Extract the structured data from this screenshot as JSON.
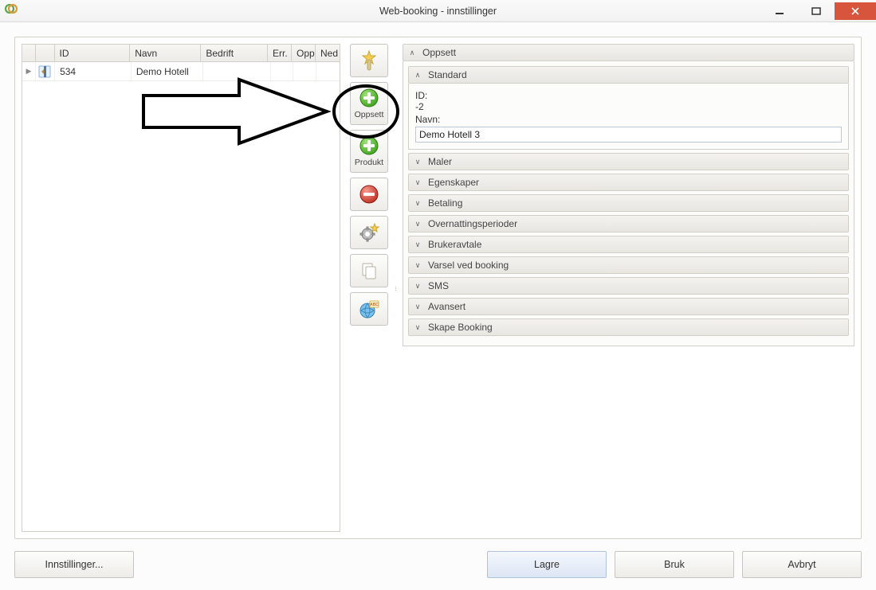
{
  "window": {
    "title": "Web-booking - innstillinger"
  },
  "grid": {
    "columns": {
      "id": "ID",
      "navn": "Navn",
      "bedrift": "Bedrift",
      "err": "Err.",
      "opp": "Opp",
      "ned": "Ned"
    },
    "rows": [
      {
        "id": "534",
        "navn": "Demo Hotell",
        "bedrift": "",
        "err": "",
        "opp": "",
        "ned": ""
      }
    ]
  },
  "toolbar": {
    "oppsett_label": "Oppsett",
    "produkt_label": "Produkt"
  },
  "accordion": {
    "top_title": "Oppsett",
    "standard": {
      "title": "Standard",
      "id_label": "ID:",
      "id_value": "-2",
      "navn_label": "Navn:",
      "navn_value": "Demo Hotell 3"
    },
    "sections": {
      "maler": "Maler",
      "egenskaper": "Egenskaper",
      "betaling": "Betaling",
      "overnatt": "Overnattingsperioder",
      "brukeravtale": "Brukeravtale",
      "varsel": "Varsel ved booking",
      "sms": "SMS",
      "avansert": "Avansert",
      "skape": "Skape Booking"
    }
  },
  "footer": {
    "settings": "Innstillinger...",
    "lagre": "Lagre",
    "bruk": "Bruk",
    "avbryt": "Avbryt"
  }
}
